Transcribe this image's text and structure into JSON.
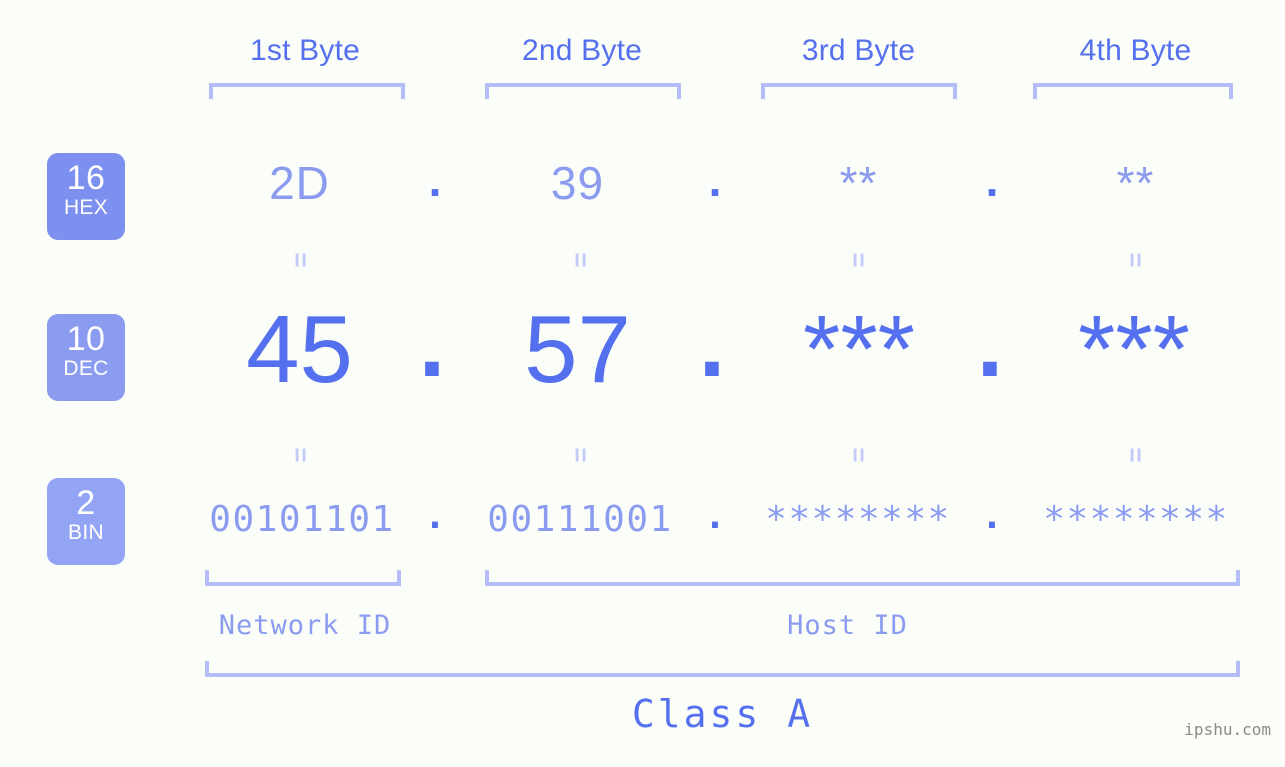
{
  "meta": {
    "background": "#fbfdf8",
    "accent_strong": "#5570ee",
    "accent_light": "#8b9cf0",
    "bracket_color": "#b4bdf7",
    "separator_color": "#c3cbf9"
  },
  "byte_headers": [
    {
      "label": "1st Byte"
    },
    {
      "label": "2nd Byte"
    },
    {
      "label": "3rd Byte"
    },
    {
      "label": "4th Byte"
    }
  ],
  "rows": [
    {
      "badge_num": "16",
      "badge_name": "HEX",
      "badge_color": "#7d90ef",
      "values": [
        "2D",
        "39",
        "**",
        "**"
      ],
      "separator": "."
    },
    {
      "badge_num": "10",
      "badge_name": "DEC",
      "badge_color": "#8b9cf0",
      "values": [
        "45",
        "57",
        "***",
        "***"
      ],
      "separator": "."
    },
    {
      "badge_num": "2",
      "badge_name": "BIN",
      "badge_color": "#93a4f4",
      "values": [
        "00101101",
        "00111001",
        "********",
        "********"
      ],
      "separator": "."
    }
  ],
  "equality_marks": {
    "glyph": "=",
    "count_per_row": 4
  },
  "segments": [
    {
      "label": "Network ID"
    },
    {
      "label": "Host ID"
    }
  ],
  "class": {
    "label": "Class A"
  },
  "watermark": {
    "text": "ipshu.com"
  }
}
